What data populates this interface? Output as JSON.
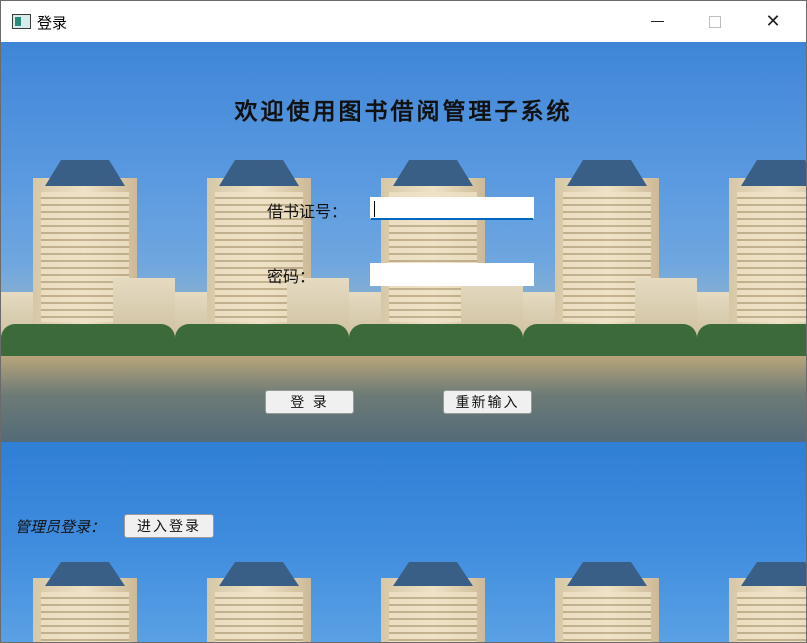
{
  "window": {
    "title": "登录"
  },
  "form": {
    "heading": "欢迎使用图书借阅管理子系统",
    "card_label": "借书证号：",
    "card_value": "",
    "password_label": "密码：",
    "password_value": "",
    "login_button": "登 录",
    "reset_button": "重新输入"
  },
  "admin": {
    "label": "管理员登录：",
    "enter_button": "进入登录"
  },
  "icons": [
    "app-icon",
    "minimize-icon",
    "maximize-icon",
    "close-icon"
  ]
}
